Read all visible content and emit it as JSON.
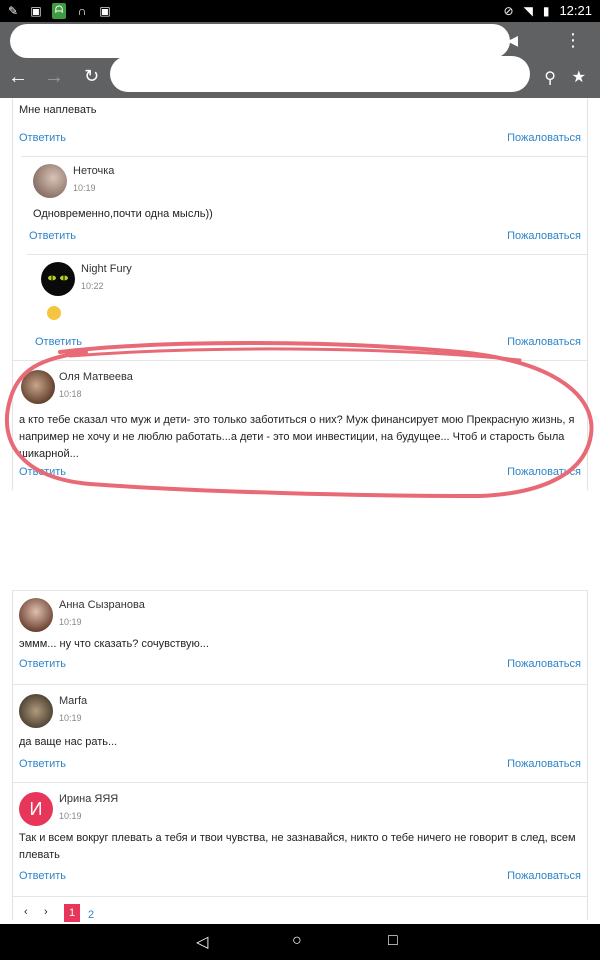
{
  "status_bar": {
    "time": "12:21",
    "left_icons": [
      "wrench-icon",
      "photo-icon",
      "app-icon",
      "headphones-icon",
      "photo-icon"
    ],
    "right_icons": [
      "do-not-disturb-icon",
      "wifi-icon",
      "battery-icon"
    ]
  },
  "browser": {
    "icons": [
      "back-arrow-icon",
      "forward-arrow-icon",
      "reload-icon",
      "search-icon",
      "bookmark-icon",
      "menu-icon"
    ]
  },
  "comments": [
    {
      "text": "Мне наплевать",
      "reply": "Ответить",
      "report": "Пожаловаться"
    },
    {
      "name": "Неточка",
      "time": "10:19",
      "text": "Одновременно,почти одна мысль))",
      "reply": "Ответить",
      "report": "Пожаловаться"
    },
    {
      "name": "Night Fury",
      "time": "10:22",
      "text": "",
      "reply": "Ответить",
      "report": "Пожаловаться"
    },
    {
      "name": "Оля Матвеева",
      "time": "10:18",
      "text": "а кто тебе сказал что муж и дети- это только заботиться о них? Муж финансирует мою Прекрасную жизнь, я например не хочу и не люблю работать...а дети - это мои инвестиции, на будущее... Чтоб и старость была шикарной...",
      "reply": "Ответить",
      "report": "Пожаловаться"
    },
    {
      "name": "Анна Сызранова",
      "time": "10:19",
      "text": "эммм... ну что сказать? сочувствую...",
      "reply": "Ответить",
      "report": "Пожаловаться"
    },
    {
      "name": "Marfa",
      "time": "10:19",
      "text": "да ваще нас рать...",
      "reply": "Ответить",
      "report": "Пожаловаться"
    },
    {
      "name": "Ирина ЯЯЯ",
      "avatar_letter": "И",
      "time": "10:19",
      "text": "Так и всем вокруг плевать а тебя и твои чувства, не зазнавайся, никто о тебе ничего не говорит в след, всем плевать",
      "reply": "Ответить",
      "report": "Пожаловаться"
    }
  ],
  "pagination": {
    "prev": "‹",
    "next": "›",
    "pages": [
      "1",
      "2"
    ],
    "current": "1"
  },
  "colors": {
    "link": "#2c84c9",
    "accent": "#e8365a",
    "annotation": "#e86a76"
  }
}
